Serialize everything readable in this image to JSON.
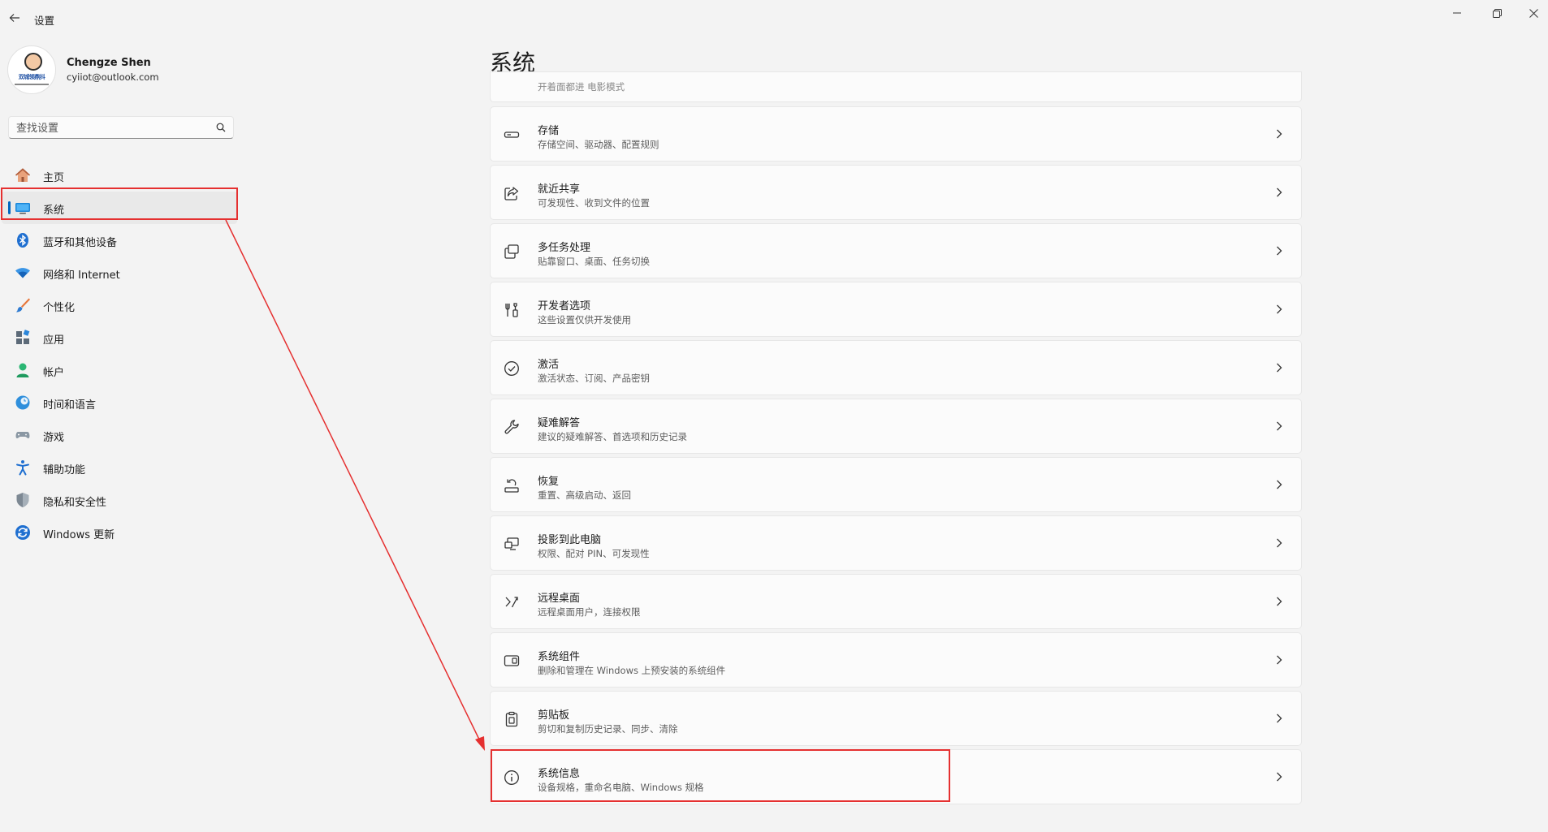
{
  "window": {
    "title": "设置"
  },
  "profile": {
    "name": "Chengze Shen",
    "email": "cyiiot@outlook.com",
    "avatar_badge_text": "双城领鼎抖"
  },
  "search": {
    "placeholder": "查找设置"
  },
  "sidebar": {
    "items": [
      {
        "label": "主页",
        "icon": "home-icon"
      },
      {
        "label": "系统",
        "icon": "system-icon",
        "active": true
      },
      {
        "label": "蓝牙和其他设备",
        "icon": "bluetooth-icon"
      },
      {
        "label": "网络和 Internet",
        "icon": "wifi-icon"
      },
      {
        "label": "个性化",
        "icon": "brush-icon"
      },
      {
        "label": "应用",
        "icon": "apps-icon"
      },
      {
        "label": "帐户",
        "icon": "account-icon"
      },
      {
        "label": "时间和语言",
        "icon": "clock-globe-icon"
      },
      {
        "label": "游戏",
        "icon": "gamepad-icon"
      },
      {
        "label": "辅助功能",
        "icon": "accessibility-icon"
      },
      {
        "label": "隐私和安全性",
        "icon": "shield-icon"
      },
      {
        "label": "Windows 更新",
        "icon": "update-icon"
      }
    ]
  },
  "main": {
    "title": "系统",
    "partial_card_text": "开着面都进 电影模式",
    "cards": [
      {
        "title": "存储",
        "subtitle": "存储空间、驱动器、配置规则",
        "icon": "storage-icon"
      },
      {
        "title": "就近共享",
        "subtitle": "可发现性、收到文件的位置",
        "icon": "share-icon"
      },
      {
        "title": "多任务处理",
        "subtitle": "贴靠窗口、桌面、任务切换",
        "icon": "multitask-icon"
      },
      {
        "title": "开发者选项",
        "subtitle": "这些设置仅供开发使用",
        "icon": "developer-icon"
      },
      {
        "title": "激活",
        "subtitle": "激活状态、订阅、产品密钥",
        "icon": "check-circle-icon"
      },
      {
        "title": "疑难解答",
        "subtitle": "建议的疑难解答、首选项和历史记录",
        "icon": "wrench-icon"
      },
      {
        "title": "恢复",
        "subtitle": "重置、高级启动、返回",
        "icon": "recovery-icon"
      },
      {
        "title": "投影到此电脑",
        "subtitle": "权限、配对 PIN、可发现性",
        "icon": "projection-icon"
      },
      {
        "title": "远程桌面",
        "subtitle": "远程桌面用户，连接权限",
        "icon": "remote-desktop-icon"
      },
      {
        "title": "系统组件",
        "subtitle": "删除和管理在 Windows 上预安装的系统组件",
        "icon": "components-icon"
      },
      {
        "title": "剪贴板",
        "subtitle": "剪切和复制历史记录、同步、清除",
        "icon": "clipboard-icon"
      },
      {
        "title": "系统信息",
        "subtitle": "设备规格，重命名电脑、Windows 规格",
        "icon": "info-icon"
      }
    ]
  },
  "colors": {
    "accent": "#0067c0",
    "annotation": "#e53030",
    "background": "#f3f3f3",
    "card": "#fbfbfb"
  }
}
